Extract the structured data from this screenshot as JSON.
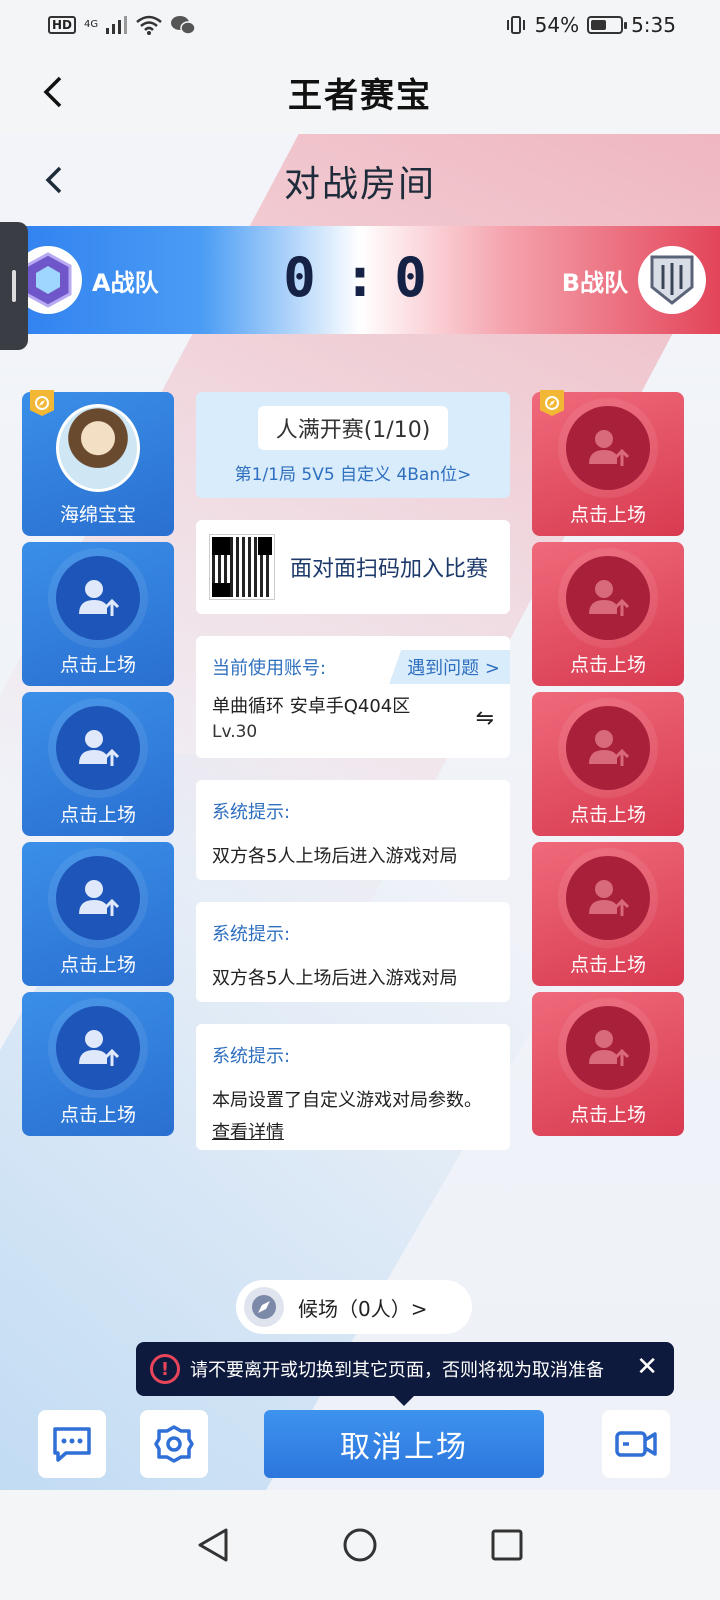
{
  "status_bar": {
    "hd": "HD",
    "network": "4G",
    "battery": "54%",
    "battery_level": 0.54,
    "time": "5:35"
  },
  "app_header": {
    "title": "王者赛宝"
  },
  "room": {
    "title": "对战房间"
  },
  "score": {
    "team_a": "A战队",
    "team_b": "B战队",
    "score_a": "0",
    "separator": ":",
    "score_b": "0"
  },
  "team_a_slots": [
    {
      "label": "海绵宝宝",
      "occupied": true
    },
    {
      "label": "点击上场",
      "occupied": false
    },
    {
      "label": "点击上场",
      "occupied": false
    },
    {
      "label": "点击上场",
      "occupied": false
    },
    {
      "label": "点击上场",
      "occupied": false
    }
  ],
  "team_b_slots": [
    {
      "label": "点击上场"
    },
    {
      "label": "点击上场"
    },
    {
      "label": "点击上场"
    },
    {
      "label": "点击上场"
    },
    {
      "label": "点击上场"
    }
  ],
  "round": {
    "status": "人满开赛(1/10)",
    "info": "第1/1局 5V5 自定义 4Ban位>"
  },
  "qr": {
    "text": "面对面扫码加入比赛"
  },
  "account": {
    "label": "当前使用账号:",
    "help": "遇到问题 >",
    "name": "单曲循环 安卓手Q404区",
    "level": "Lv.30",
    "switch_icon": "⇋"
  },
  "tips": [
    {
      "title": "系统提示:",
      "text": "双方各5人上场后进入游戏对局"
    },
    {
      "title": "系统提示:",
      "text": "双方各5人上场后进入游戏对局"
    },
    {
      "title": "系统提示:",
      "text": "本局设置了自定义游戏对局参数。",
      "link": "查看详情"
    }
  ],
  "bench": {
    "label": "候场（0人）>"
  },
  "toast": {
    "text": "请不要离开或切换到其它页面，否则将视为取消准备"
  },
  "actions": {
    "main": "取消上场"
  },
  "colors": {
    "team_a": "#2f7ff0",
    "team_b": "#e34459",
    "accent": "#2f6fbf"
  }
}
